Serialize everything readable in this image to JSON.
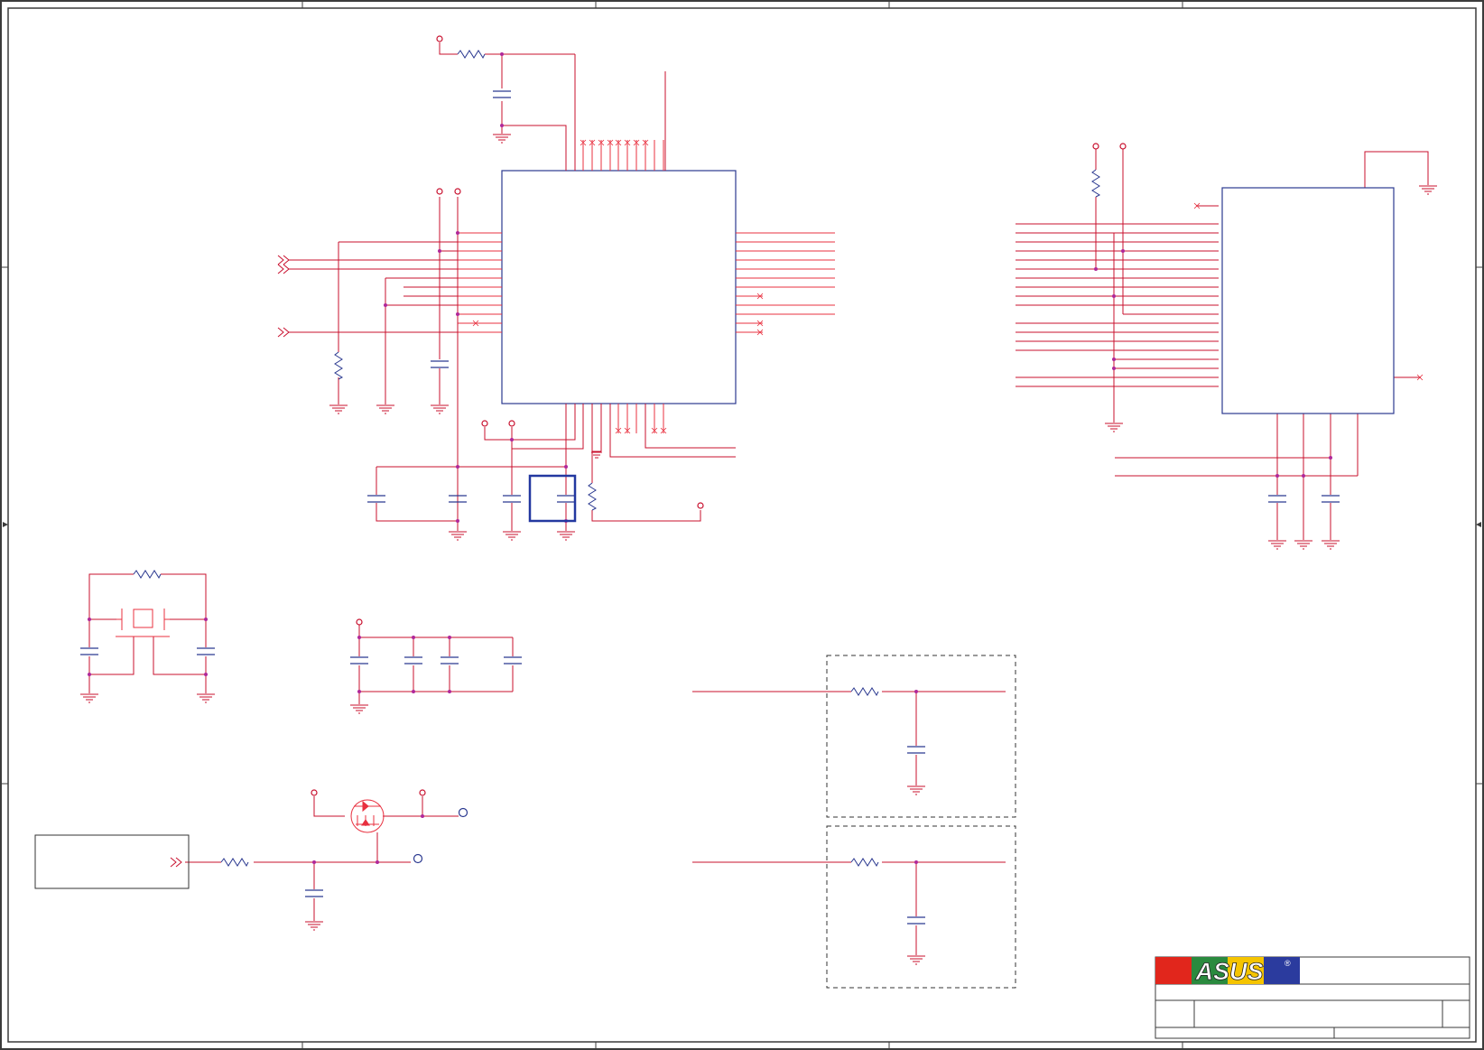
{
  "diagram": {
    "type": "electrical-schematic",
    "colors": {
      "wire": "#c8102e",
      "pin": "#e8303f",
      "passive": "#2b3990",
      "junction": "#b0279a",
      "border": "#3b3b3b",
      "highlight": "#2338a0",
      "dashed_box": "#333333"
    }
  },
  "title_block": {
    "logo_text": "ASUS",
    "logo_mark": "®",
    "logo_colors": [
      "#e1261c",
      "#2a8a3e",
      "#f5c400",
      "#2b3b9e"
    ]
  }
}
